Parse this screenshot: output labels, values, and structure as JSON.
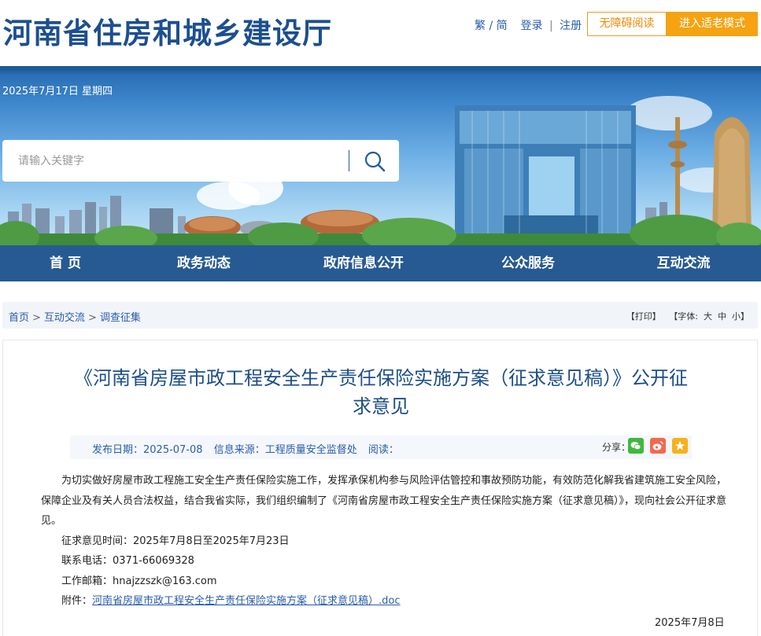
{
  "header": {
    "site_title": "河南省住房和城乡建设厅",
    "lang_label": "繁 / 简",
    "login_label": "登录",
    "register_label": "注册",
    "accessibility_label": "无障碍阅读",
    "elderly_mode_label": "进入适老模式"
  },
  "banner": {
    "date": "2025年7月17日 星期四"
  },
  "search": {
    "placeholder": "请输入关键字",
    "icon": "search-icon"
  },
  "nav": {
    "items": [
      "首 页",
      "政务动态",
      "政府信息公开",
      "公众服务",
      "互动交流"
    ]
  },
  "breadcrumb": {
    "items": [
      "首页",
      "互动交流",
      "调查征集"
    ],
    "separator": ">"
  },
  "tools": {
    "print": "【打印】",
    "font_prefix": "【字体:",
    "font_large": "大",
    "font_medium": "中",
    "font_small": "小",
    "font_suffix": "】"
  },
  "article": {
    "title": "《河南省房屋市政工程安全生产责任保险实施方案（征求意见稿）》公开征求意见",
    "publish_date": "发布日期：2025-07-08",
    "source": "信息来源：工程质量安全监督处",
    "reads": "阅读：",
    "share_label": "分享：",
    "share_icons": [
      "wechat-icon",
      "weibo-icon",
      "favorite-icon"
    ],
    "paragraph": "为切实做好房屋市政工程施工安全生产责任保险实施工作，发挥承保机构参与风险评估管控和事故预防功能，有效防范化解我省建筑施工安全风险，保障企业及有关人员合法权益，结合我省实际，我们组织编制了《河南省房屋市政工程安全生产责任保险实施方案（征求意见稿）》，现向社会公开征求意见。",
    "period": "征求意见时间：2025年7月8日至2025年7月23日",
    "phone": "联系电话：0371-66069328",
    "email": "工作邮箱：hnajzzszk@163.com",
    "attachment_label": "附件：",
    "attachment_link": "河南省房屋市政工程安全生产责任保险实施方案（征求意见稿）.doc",
    "sign_date": "2025年7月8日"
  },
  "colors": {
    "brand_blue": "#1c4f8f",
    "nav_bg": "#275a92",
    "accent_orange": "#f5a312",
    "link_blue": "#2a5da8"
  }
}
